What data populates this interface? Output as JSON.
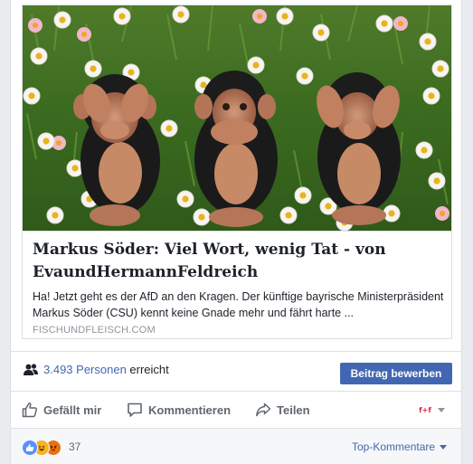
{
  "link_preview": {
    "image_alt": "Drei Affenfiguren zwischen Gänseblümchen",
    "headline": "Markus Söder: Viel Wort, wenig Tat - von EvaundHermannFeldreich",
    "description": "Ha! Jetzt geht es der AfD an den Kragen. Der künftige bayrische Ministerpräsident Markus Söder (CSU) kennt keine Gnade mehr und fährt harte ...",
    "domain": "FISCHUNDFLEISCH.COM"
  },
  "reach": {
    "count": "3.493 Personen",
    "suffix": " erreicht",
    "boost_button": "Beitrag bewerben",
    "icon": "people-icon"
  },
  "actions": {
    "like": "Gefällt mir",
    "comment": "Kommentieren",
    "share": "Teilen",
    "page_avatar_label": "f+f"
  },
  "reactions": {
    "types": [
      "like",
      "haha",
      "angry"
    ],
    "count": "37",
    "sort_label": "Top-Kommentare"
  },
  "colors": {
    "accent": "#4267b2",
    "muted": "#606770",
    "border": "#dddfe2"
  }
}
